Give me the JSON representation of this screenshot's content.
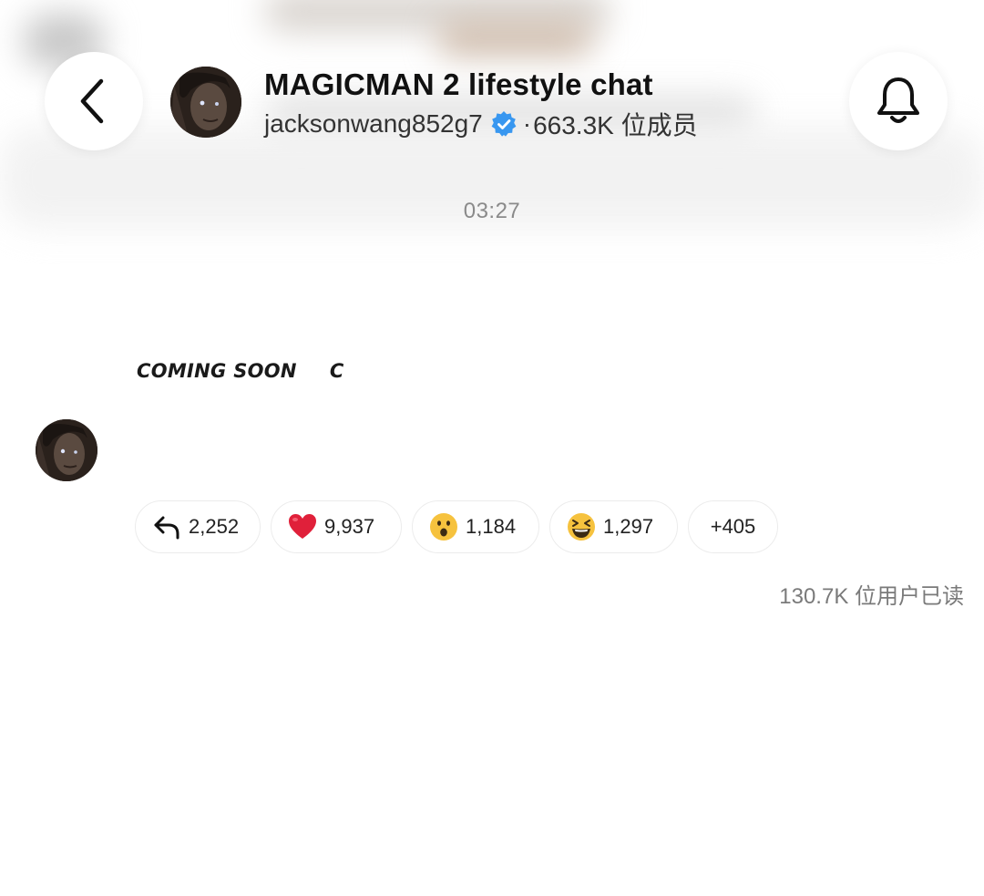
{
  "header": {
    "title": "MAGICMAN 2 lifestyle chat",
    "username": "jacksonwang852g7",
    "separator": "·",
    "members": "663.3K 位成员",
    "back_icon": "chevron-left-icon",
    "bell_icon": "bell-icon",
    "verified_color": "#3897f0"
  },
  "timestamp": "03:27",
  "message": {
    "media_text": "COMING SOON",
    "media_text_cut": "C",
    "reactions": [
      {
        "icon": "reply-icon",
        "count": "2,252"
      },
      {
        "icon": "red-heart-emoji",
        "count": "9,937"
      },
      {
        "icon": "surprised-face-emoji",
        "count": "1,184"
      },
      {
        "icon": "laughing-face-emoji",
        "count": "1,297"
      },
      {
        "icon": "more-reactions",
        "count": "+405"
      }
    ],
    "seen_by": "130.7K 位用户已读"
  }
}
